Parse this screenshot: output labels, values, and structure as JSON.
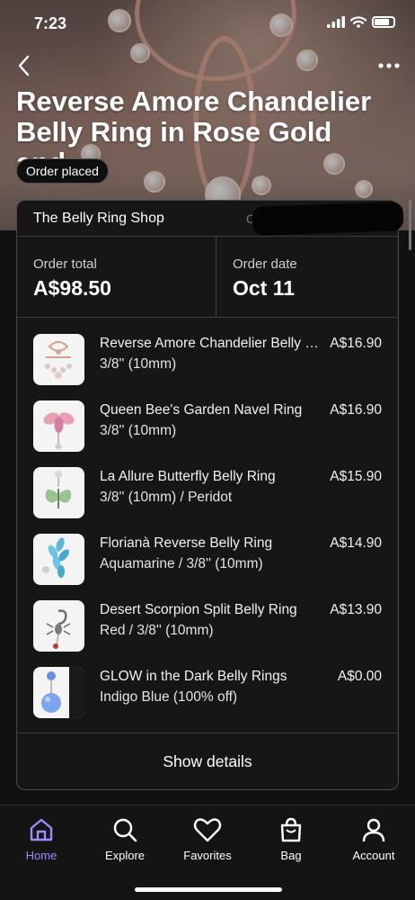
{
  "status_bar": {
    "time": "7:23"
  },
  "hero": {
    "title": "Reverse Amore Chandelier\nBelly Ring in Rose Gold and...",
    "status": "Order placed"
  },
  "order": {
    "shop_name": "The Belly Ring Shop",
    "order_ref_label": "Ord",
    "total_label": "Order total",
    "total_value": "A$98.50",
    "date_label": "Order date",
    "date_value": "Oct 11"
  },
  "items": [
    {
      "name": "Reverse Amore Chandelier Belly Ring in Rose Gold and Clear",
      "variant": "3/8'' (10mm)",
      "price": "A$16.90"
    },
    {
      "name": "Queen Bee's Garden Navel Ring",
      "variant": "3/8'' (10mm)",
      "price": "A$16.90"
    },
    {
      "name": "La Allure Butterfly Belly Ring",
      "variant": "3/8'' (10mm) / Peridot",
      "price": "A$15.90"
    },
    {
      "name": "Florianà Reverse Belly Ring",
      "variant": "Aquamarine / 3/8'' (10mm)",
      "price": "A$14.90"
    },
    {
      "name": "Desert Scorpion Split Belly Ring",
      "variant": "Red / 3/8'' (10mm)",
      "price": "A$13.90"
    },
    {
      "name": "GLOW in the Dark Belly Rings",
      "variant": "Indigo Blue (100% off)",
      "price": "A$0.00"
    }
  ],
  "show_details_label": "Show details",
  "tabs": [
    {
      "label": "Home",
      "icon": "home-icon",
      "active": true
    },
    {
      "label": "Explore",
      "icon": "search-icon",
      "active": false
    },
    {
      "label": "Favorites",
      "icon": "heart-icon",
      "active": false
    },
    {
      "label": "Bag",
      "icon": "bag-icon",
      "active": false
    },
    {
      "label": "Account",
      "icon": "person-icon",
      "active": false
    }
  ],
  "colors": {
    "accent": "#9b8cff",
    "background": "#111111",
    "card": "#161616"
  }
}
